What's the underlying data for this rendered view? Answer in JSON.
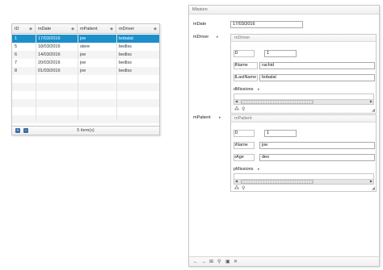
{
  "grid": {
    "columns": [
      {
        "label": "ID"
      },
      {
        "label": "mDate"
      },
      {
        "label": "mPatient"
      },
      {
        "label": "mDriver"
      }
    ],
    "rows": [
      {
        "id": "1",
        "date": "17/03/2016",
        "patient": "joe",
        "driver": "bobalal",
        "selected": true
      },
      {
        "id": "5",
        "date": "18/03/2016",
        "patient": "stere",
        "driver": "bedlss",
        "selected": false
      },
      {
        "id": "6",
        "date": "14/03/2016",
        "patient": "joe",
        "driver": "bedlss",
        "selected": false
      },
      {
        "id": "7",
        "date": "20/03/2016",
        "patient": "joe",
        "driver": "bedlss",
        "selected": false
      },
      {
        "id": "8",
        "date": "01/03/2016",
        "patient": "joe",
        "driver": "bedlss",
        "selected": false
      }
    ],
    "footer_text": "5 item(s)",
    "footer_icons": [
      "add-icon",
      "remove-icon"
    ]
  },
  "mission": {
    "title": "Mission",
    "mdate_label": "mDate",
    "mdate_value": "17/03/2016",
    "mdriver_label": "mDriver",
    "mpatient_label": "mPatient",
    "driver": {
      "title": "mDriver",
      "id_label": "ID",
      "id_value": "1",
      "name_label": "dName",
      "name_value": "rachid",
      "lastname_label": "dLastName",
      "lastname_value": "bobalal",
      "missions_label": "dMissions"
    },
    "patient": {
      "title": "mPatient",
      "id_label": "ID",
      "id_value": "1",
      "name_label": "pName",
      "name_value": "joe",
      "age_label": "pAge",
      "age_value": "deo",
      "missions_label": "pMissions"
    },
    "bottom_icons": [
      "arrow-left-icon",
      "arrow-right-icon",
      "add-icon",
      "search-icon",
      "save-icon",
      "delete-icon"
    ]
  }
}
